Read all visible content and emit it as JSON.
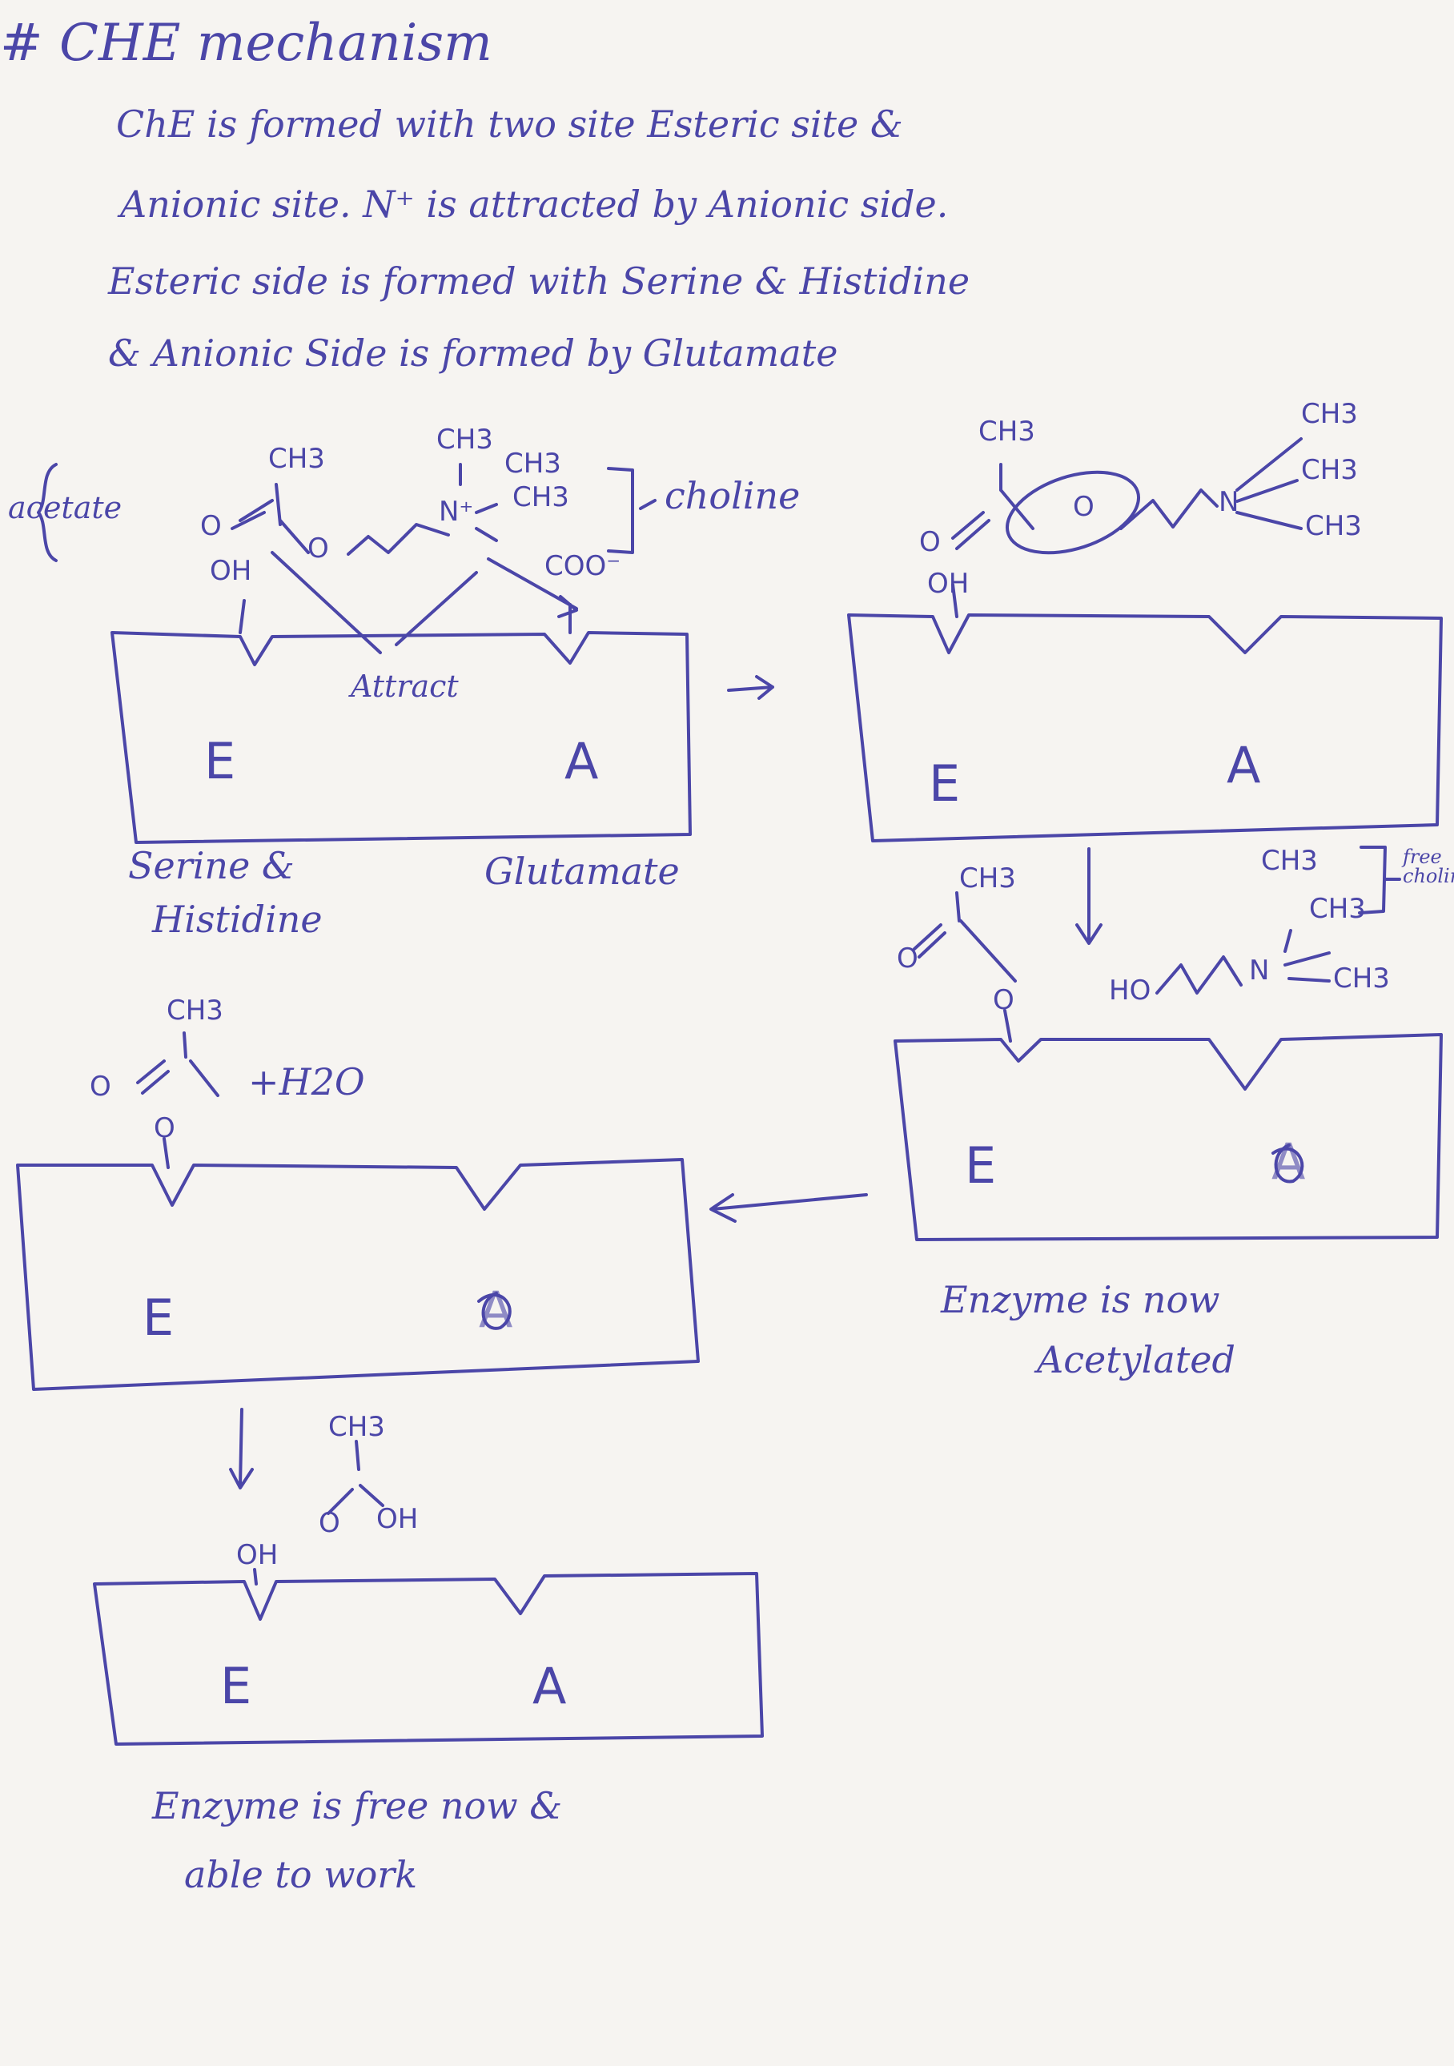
{
  "heading": {
    "title": "# CHE mechanism"
  },
  "intro": {
    "line1": "ChE is formed with two site Esteric site &",
    "line2": "Anionic site. N⁺ is attracted by Anionic side.",
    "line3": "Esteric side is formed with Serine & Histidine",
    "line4": "& Anionic Side is formed by Glutamate"
  },
  "step1": {
    "acetate_label": "acetate",
    "choline_label": "choline",
    "attract_label": "Attract",
    "ch3_a": "CH3",
    "ch3_b": "CH3",
    "ch3_c": "CH3",
    "ch3_d": "CH3",
    "n_plus": "N⁺",
    "o_carbonyl": "O",
    "o_ester": "O",
    "oh": "OH",
    "coo": "COO⁻",
    "site_e": "E",
    "site_a": "A",
    "serine_label": "Serine &",
    "histidine_label": "Histidine",
    "glutamate_label": "Glutamate"
  },
  "step2": {
    "ch3_acyl": "CH3",
    "o_carbonyl": "O",
    "o_ring": "O",
    "oh": "OH",
    "n": "N",
    "ch3_n1": "CH3",
    "ch3_n2": "CH3",
    "ch3_n3": "CH3",
    "site_e": "E",
    "site_a": "A"
  },
  "step3": {
    "ch3_acyl": "CH3",
    "o_carbonyl": "O",
    "o_link": "O",
    "free_choline_label": "free choline",
    "ho": "HO",
    "n": "N",
    "ch3_n1": "CH3",
    "ch3_n2": "CH3",
    "ch3_n3": "CH3",
    "site_e": "E",
    "site_a": "A",
    "note_line1": "Enzyme is now",
    "note_line2": "Acetylated"
  },
  "step4": {
    "ch3": "CH3",
    "o_carbonyl": "O",
    "water": "+H2O",
    "o_link": "O",
    "site_e": "E",
    "site_a": "A"
  },
  "step5": {
    "ch3": "CH3",
    "o_carbonyl": "O",
    "oh_acid": "OH",
    "oh_enzyme": "OH",
    "site_e": "E",
    "site_a": "A",
    "note_line1": "Enzyme is free now &",
    "note_line2": "able to work"
  }
}
